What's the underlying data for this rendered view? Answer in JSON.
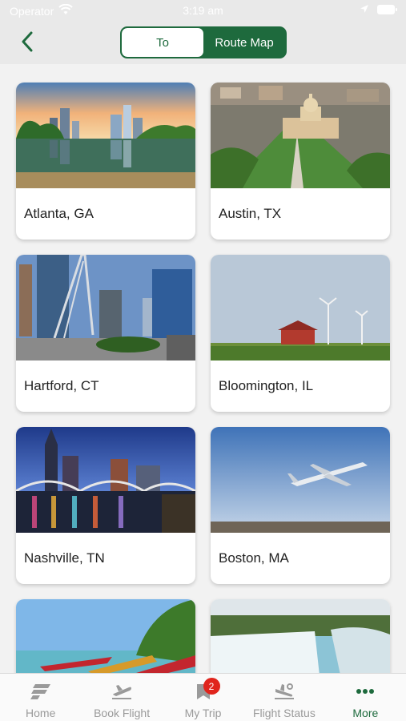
{
  "status_bar": {
    "carrier": "Operator",
    "time": "3:19 am"
  },
  "header": {
    "back_icon": "chevron-left-icon",
    "tabs": [
      {
        "label": "To",
        "active": true
      },
      {
        "label": "Route Map",
        "active": false
      }
    ]
  },
  "destinations": [
    {
      "city": "Atlanta, GA",
      "image": "atlanta-skyline-lake"
    },
    {
      "city": "Austin, TX",
      "image": "austin-capitol-aerial"
    },
    {
      "city": "Hartford, CT",
      "image": "hartford-downtown-bridge"
    },
    {
      "city": "Bloomington, IL",
      "image": "bloomington-barn-wind-turbines"
    },
    {
      "city": "Nashville, TN",
      "image": "nashville-night-bridge"
    },
    {
      "city": "Boston, MA",
      "image": "airplane-takeoff"
    },
    {
      "city": "",
      "image": "beach-boats"
    },
    {
      "city": "",
      "image": "niagara-falls"
    }
  ],
  "tabbar": {
    "items": [
      {
        "label": "Home",
        "icon": "home-logo-icon",
        "active": false
      },
      {
        "label": "Book Flight",
        "icon": "plane-takeoff-icon",
        "active": false
      },
      {
        "label": "My Trip",
        "icon": "bookmark-icon",
        "active": false,
        "badge": "2"
      },
      {
        "label": "Flight Status",
        "icon": "plane-landing-icon",
        "active": false
      },
      {
        "label": "More",
        "icon": "more-dots-icon",
        "active": true
      }
    ]
  },
  "colors": {
    "brand_green": "#1e6a3d",
    "badge_red": "#e0241c",
    "inactive_gray": "#9a9a9a"
  }
}
